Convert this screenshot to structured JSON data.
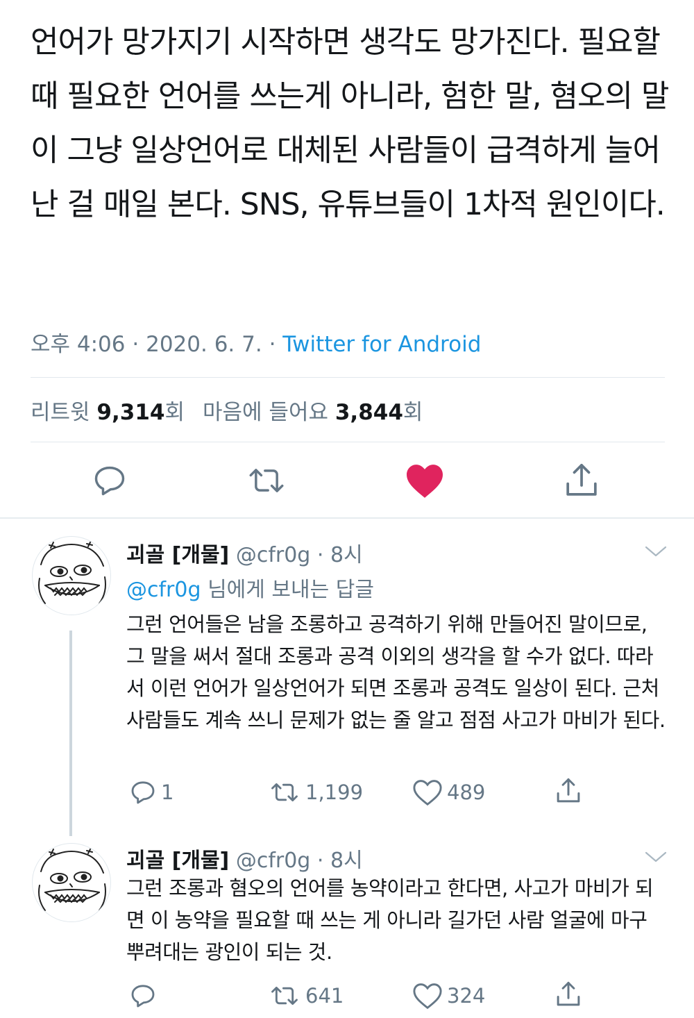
{
  "tweet": {
    "text": "언어가 망가지기 시작하면 생각도 망가진다. 필요할 때 필요한 언어를 쓰는게 아니라, 험한 말, 혐오의 말이 그냥 일상언어로 대체된 사람들이 급격하게 늘어난 걸 매일 본다. SNS, 유튜브들이 1차적 원인이다.",
    "time": "오후 4:06",
    "date": "2020. 6. 7.",
    "separator": "·",
    "source": "Twitter for Android",
    "retweets_label": "리트윗",
    "retweets_count": "9,314",
    "retweets_suffix": "회",
    "likes_label": "마음에 들어요",
    "likes_count": "3,844",
    "likes_suffix": "회"
  },
  "icons": {
    "reply": "reply-icon",
    "retweet": "retweet-icon",
    "like": "heart-icon",
    "share": "share-icon",
    "caret": "chevron-down-icon"
  },
  "colors": {
    "like_active": "#e0245e",
    "link": "#1b95e0",
    "muted": "#657786"
  },
  "replies": [
    {
      "name": "괴골 [개물]",
      "handle": "@cfr0g",
      "dot": "·",
      "time": "8시",
      "replying_to_handle": "@cfr0g",
      "replying_to_text": "님에게 보내는 답글",
      "text": "그런 언어들은 남을 조롱하고 공격하기 위해 만들어진 말이므로, 그 말을 써서 절대 조롱과 공격 이외의 생각을 할 수가 없다. 따라서 이런 언어가 일상언어가 되면 조롱과 공격도 일상이 된다. 근처 사람들도 계속 쓰니 문제가 없는 줄 알고 점점 사고가 마비가 된다.",
      "replies": "1",
      "retweets": "1,199",
      "likes": "489"
    },
    {
      "name": "괴골 [개물]",
      "handle": "@cfr0g",
      "dot": "·",
      "time": "8시",
      "text": "그런 조롱과 혐오의 언어를 농약이라고 한다면, 사고가 마비가 되면 이 농약을 필요할 때 쓰는 게 아니라 길가던 사람 얼굴에 마구 뿌려대는 광인이 되는 것.",
      "retweets": "641",
      "likes": "324"
    }
  ]
}
